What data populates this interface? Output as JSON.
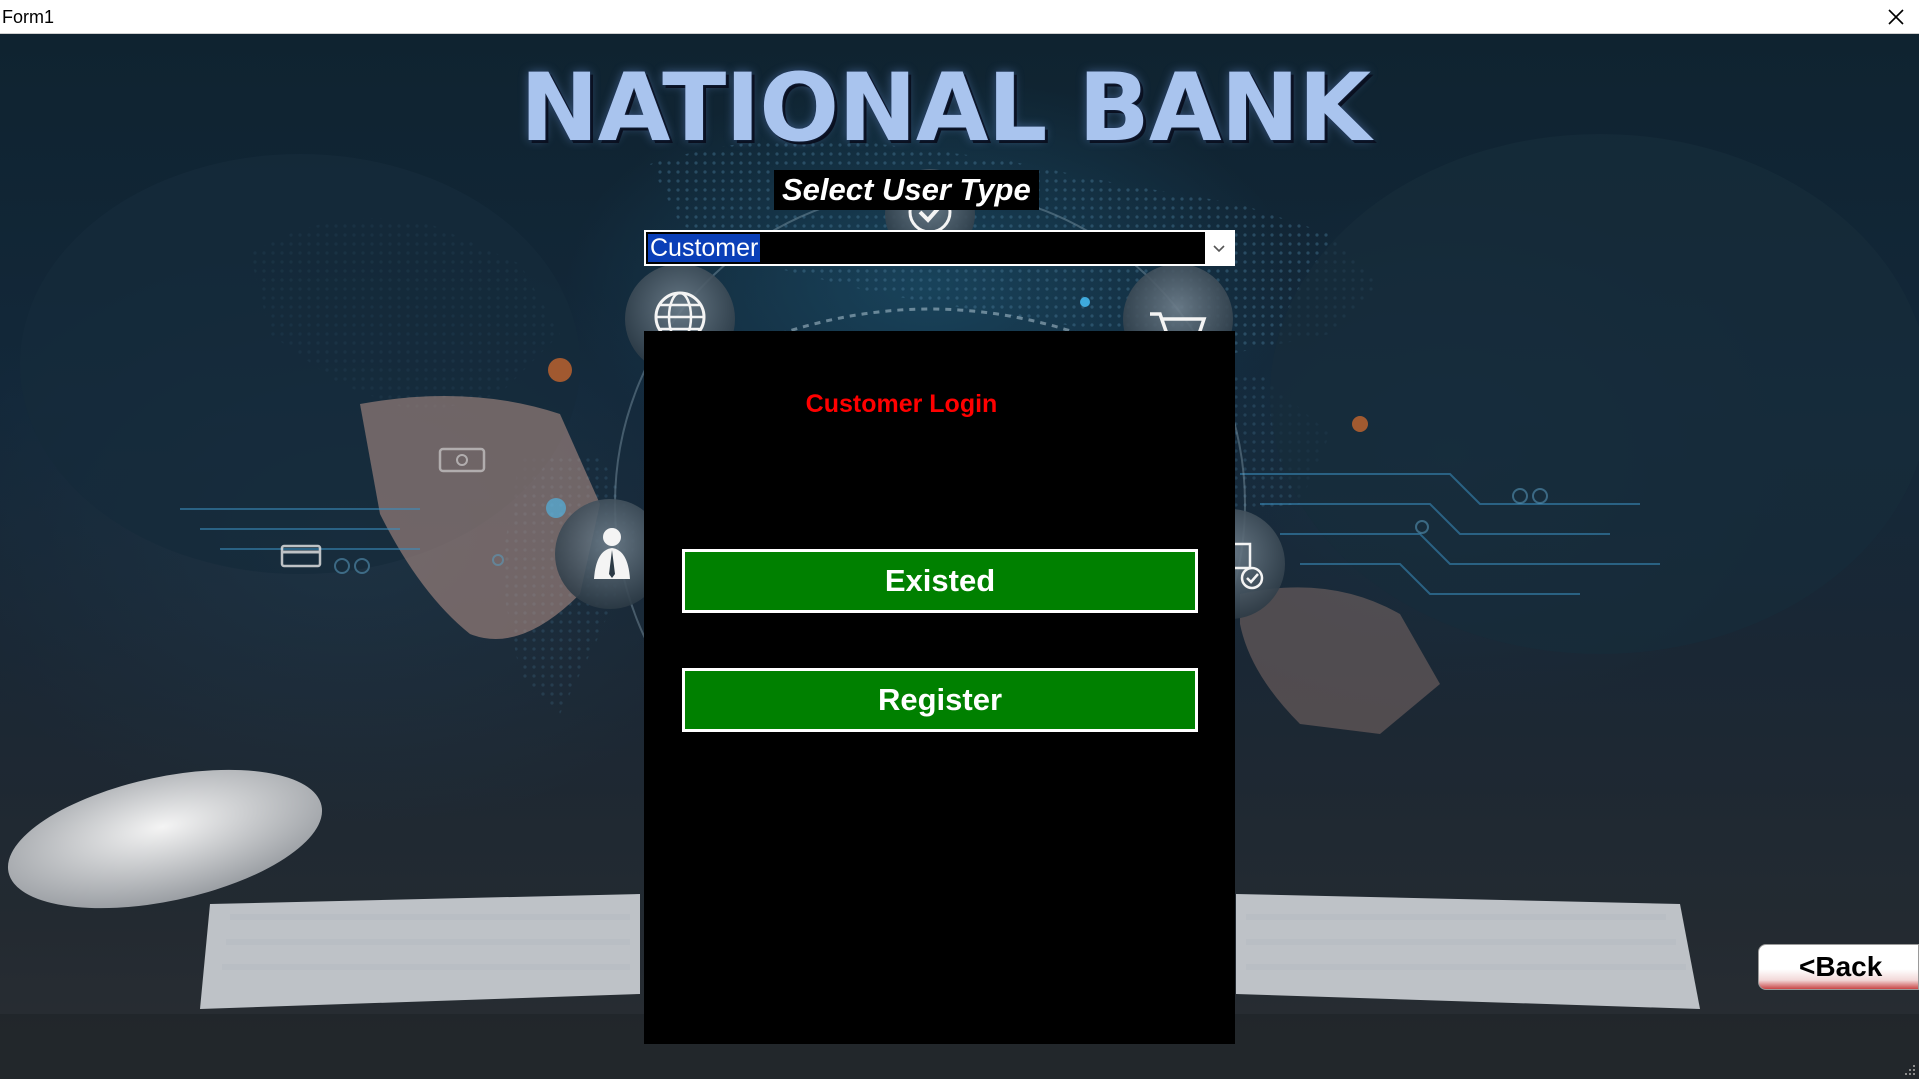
{
  "window": {
    "title": "Form1",
    "close_icon": "close-icon"
  },
  "header": {
    "brand": "NATIONAL BANK",
    "select_label": "Select User Type"
  },
  "user_type_select": {
    "selected": "Customer",
    "arrow_icon": "chevron-down-icon"
  },
  "login_panel": {
    "title": "Customer Login",
    "existed_label": "Existed",
    "register_label": "Register"
  },
  "navigation": {
    "back_label": "<Back"
  },
  "background_icons": [
    "globe-icon",
    "shopping-cart-icon",
    "checkmark-icon",
    "businessman-icon",
    "document-check-icon",
    "credit-card-icon",
    "cash-icon"
  ],
  "colors": {
    "panel_bg": "#000000",
    "button_green": "#008000",
    "title_red": "#ff0000",
    "selection_blue": "#0a3fb8",
    "brand_text": "#a9c4ee"
  }
}
